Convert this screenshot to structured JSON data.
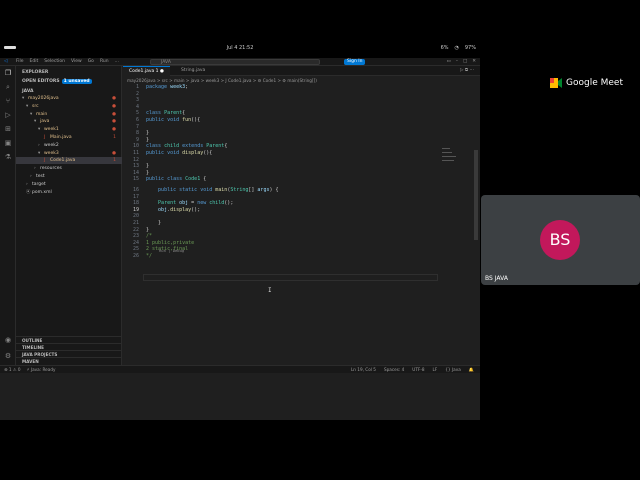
{
  "os_bar": {
    "clock": "Jul 4  21:52",
    "battery": "97%",
    "volume": "6%"
  },
  "titlebar": {
    "menu": [
      "File",
      "Edit",
      "Selection",
      "View",
      "Go",
      "Run",
      "..."
    ],
    "search": "JAVA",
    "sign_in": "Sign In"
  },
  "sidebar": {
    "explorer": "EXPLORER",
    "open_editors": "OPEN EDITORS",
    "open_editors_badge": "1 unsaved",
    "project": "JAVA",
    "tree": [
      {
        "name": "may2026java",
        "mark": "●"
      },
      {
        "name": "src",
        "mark": "●"
      },
      {
        "name": "main",
        "mark": "●"
      },
      {
        "name": "java",
        "mark": "●"
      },
      {
        "name": "week1",
        "mark": "●"
      },
      {
        "name": "Main.java",
        "mark": "1"
      },
      {
        "name": "week2",
        "mark": ""
      },
      {
        "name": "week3",
        "mark": "●"
      },
      {
        "name": "Code1.java",
        "mark": "1"
      },
      {
        "name": "resources",
        "mark": ""
      },
      {
        "name": "test",
        "mark": ""
      },
      {
        "name": "target",
        "mark": ""
      },
      {
        "name": "pom.xml",
        "mark": ""
      }
    ],
    "outline": [
      "OUTLINE",
      "TIMELINE",
      "JAVA PROJECTS",
      "MAVEN"
    ]
  },
  "tabs": [
    {
      "label": "Code1.java 1",
      "active": true
    },
    {
      "label": "String.java",
      "active": false
    }
  ],
  "breadcrumb": "may2026java > src > main > java > week3 > J Code1.java > ⚙ Code1 > ⚙ main(String[])",
  "code": {
    "lines": [
      {
        "n": "1",
        "text": "package week3;"
      },
      {
        "n": "2",
        "text": ""
      },
      {
        "n": "3",
        "text": ""
      },
      {
        "n": "4",
        "text": ""
      },
      {
        "n": "5",
        "text": "class Parent{"
      },
      {
        "n": "6",
        "text": "public void fun(){"
      },
      {
        "n": "7",
        "text": ""
      },
      {
        "n": "8",
        "text": "}"
      },
      {
        "n": "9",
        "text": "}"
      },
      {
        "n": "10",
        "text": "class child extends Parent{"
      },
      {
        "n": "11",
        "text": "public void display(){"
      },
      {
        "n": "12",
        "text": ""
      },
      {
        "n": "13",
        "text": "}"
      },
      {
        "n": "14",
        "text": "}"
      },
      {
        "n": "15",
        "text": "public class Code1 {"
      },
      {
        "n": "16",
        "text": "    public static void main(String[] args) {"
      },
      {
        "n": "17",
        "text": ""
      },
      {
        "n": "18",
        "text": "    Parent obj = new child();"
      },
      {
        "n": "19",
        "text": "    obj.display();"
      },
      {
        "n": "20",
        "text": ""
      },
      {
        "n": "21",
        "text": "    }"
      },
      {
        "n": "22",
        "text": "}"
      },
      {
        "n": "23",
        "text": "/*"
      },
      {
        "n": "24",
        "text": "1 public,private"
      },
      {
        "n": "25",
        "text": "2 static,final"
      },
      {
        "n": "26",
        "text": "*/"
      }
    ],
    "codelens": "Run | Debug"
  },
  "statusbar": {
    "left": [
      "⊗ 1 ⚠ 0",
      "⚡ Java: Ready"
    ],
    "right": [
      "Ln 19, Col 5",
      "Spaces: 4",
      "UTF-8",
      "LF",
      "{} Java",
      "🔔"
    ]
  },
  "meet": {
    "logo_text": "Google Meet",
    "participant_initials": "BS",
    "participant_name": "BS JAVA",
    "avatar_color": "#c2185b"
  }
}
